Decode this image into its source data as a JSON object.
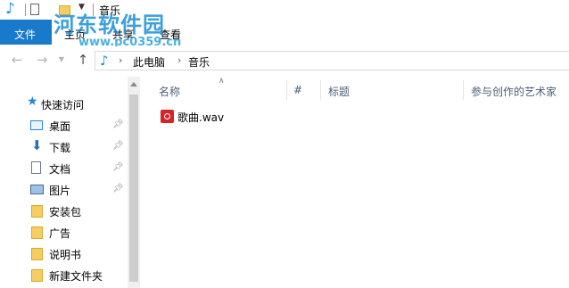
{
  "window": {
    "title": "音乐"
  },
  "ribbon": {
    "tabs": [
      {
        "label": "文件"
      },
      {
        "label": "主页"
      },
      {
        "label": "共享"
      },
      {
        "label": "查看"
      }
    ]
  },
  "watermark": {
    "title": "河东软件园",
    "url": "www.pc0359.cn"
  },
  "address": {
    "crumbs": [
      "此电脑",
      "音乐"
    ]
  },
  "nav": {
    "quick_access": "快速访问",
    "items": [
      {
        "label": "桌面",
        "icon": "desktop-icon",
        "pinned": true
      },
      {
        "label": "下载",
        "icon": "download-icon",
        "pinned": true
      },
      {
        "label": "文档",
        "icon": "document-icon",
        "pinned": true
      },
      {
        "label": "图片",
        "icon": "pictures-icon",
        "pinned": true
      },
      {
        "label": "安装包",
        "icon": "folder-icon",
        "pinned": false
      },
      {
        "label": "广告",
        "icon": "folder-icon",
        "pinned": false
      },
      {
        "label": "说明书",
        "icon": "folder-icon",
        "pinned": false
      },
      {
        "label": "新建文件夹",
        "icon": "folder-icon",
        "pinned": false
      }
    ]
  },
  "columns": {
    "name": "名称",
    "number": "#",
    "title": "标题",
    "artist": "参与创作的艺术家"
  },
  "files": [
    {
      "name": "歌曲.wav",
      "icon": "music-file-icon"
    }
  ],
  "colors": {
    "accent": "#1979ca",
    "folder": "#f5cd62",
    "music_icon": "#d6232a"
  }
}
